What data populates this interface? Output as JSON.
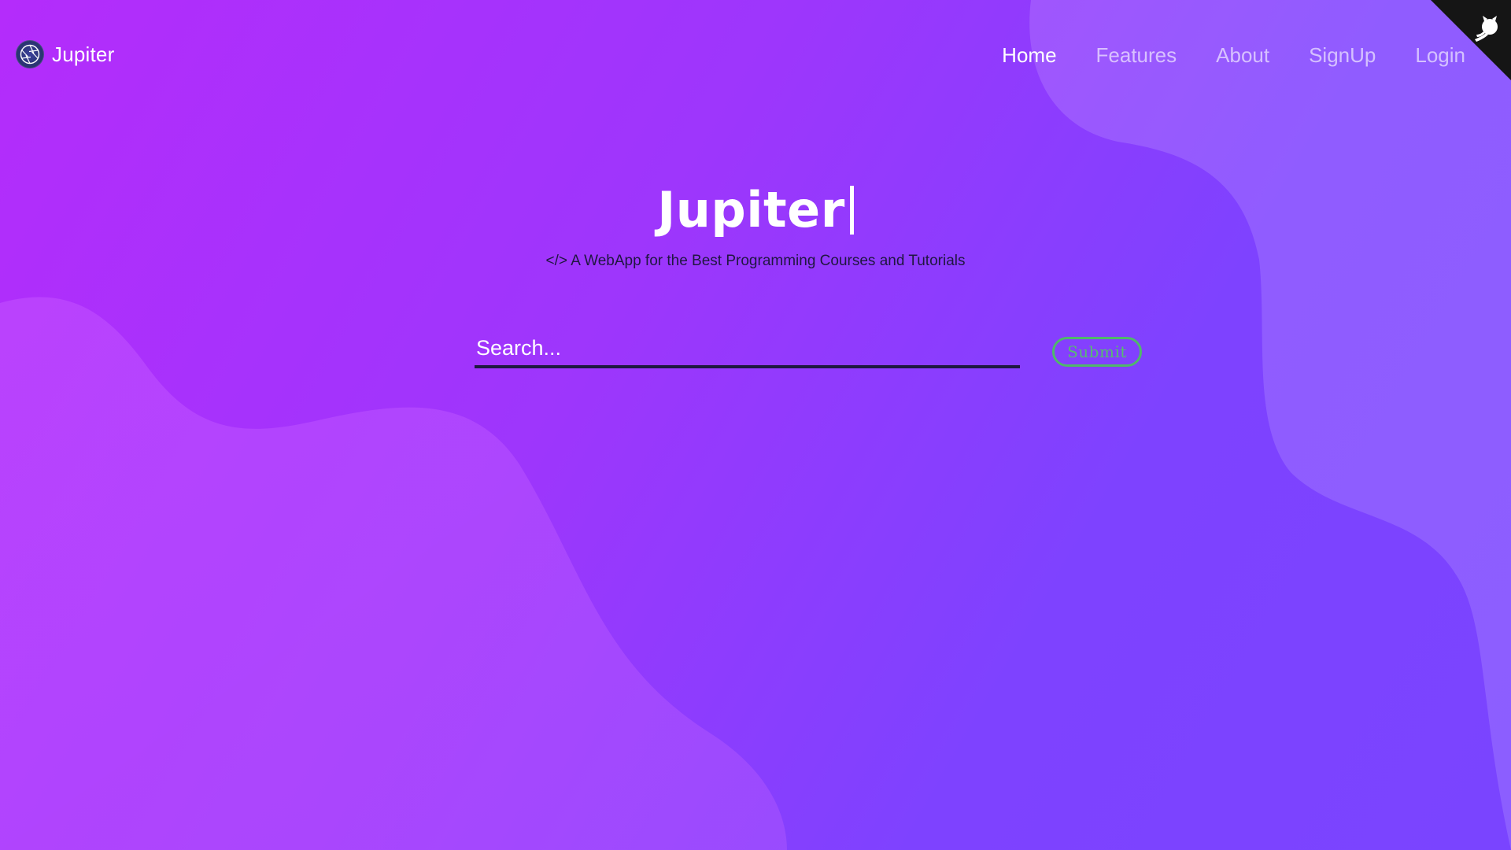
{
  "brand": {
    "name": "Jupiter",
    "logo_icon": "aperture-icon"
  },
  "nav": {
    "items": [
      {
        "label": "Home",
        "active": true
      },
      {
        "label": "Features",
        "active": false
      },
      {
        "label": "About",
        "active": false
      },
      {
        "label": "SignUp",
        "active": false
      },
      {
        "label": "Login",
        "active": false
      }
    ]
  },
  "corner": {
    "icon": "github-octocat-icon"
  },
  "hero": {
    "title": "Jupiter",
    "subtitle": "</> A WebApp for the Best Programming Courses and Tutorials"
  },
  "search": {
    "placeholder": "Search...",
    "value": "",
    "submit_label": "Submit"
  },
  "colors": {
    "gradient_start": "#b42cfb",
    "gradient_end": "#7a44ff",
    "submit_accent": "#4fb86a",
    "input_underline": "#1e1840",
    "text_primary": "#ffffff"
  }
}
